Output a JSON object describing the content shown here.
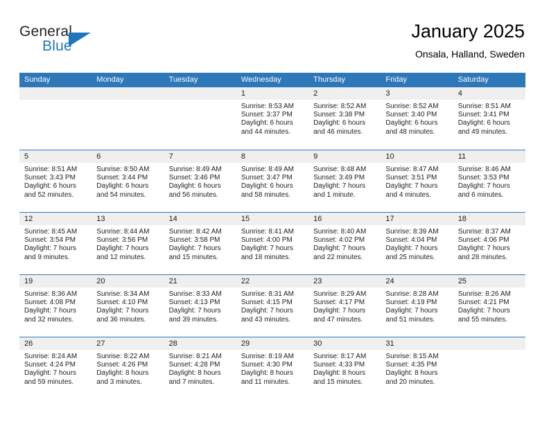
{
  "brand": {
    "name_part1": "General",
    "name_part2": "Blue",
    "flag_icon": "triangle-flag-icon",
    "accent_color": "#1f76bd"
  },
  "header": {
    "title": "January 2025",
    "location": "Onsala, Halland, Sweden"
  },
  "calendar": {
    "header_bg": "#2e77b8",
    "day_band_bg": "#efefef",
    "weekdays": [
      "Sunday",
      "Monday",
      "Tuesday",
      "Wednesday",
      "Thursday",
      "Friday",
      "Saturday"
    ],
    "weeks": [
      [
        {
          "day": "",
          "empty": true
        },
        {
          "day": "",
          "empty": true
        },
        {
          "day": "",
          "empty": true
        },
        {
          "day": "1",
          "sunrise": "Sunrise: 8:53 AM",
          "sunset": "Sunset: 3:37 PM",
          "daylight_line1": "Daylight: 6 hours",
          "daylight_line2": "and 44 minutes."
        },
        {
          "day": "2",
          "sunrise": "Sunrise: 8:52 AM",
          "sunset": "Sunset: 3:38 PM",
          "daylight_line1": "Daylight: 6 hours",
          "daylight_line2": "and 46 minutes."
        },
        {
          "day": "3",
          "sunrise": "Sunrise: 8:52 AM",
          "sunset": "Sunset: 3:40 PM",
          "daylight_line1": "Daylight: 6 hours",
          "daylight_line2": "and 48 minutes."
        },
        {
          "day": "4",
          "sunrise": "Sunrise: 8:51 AM",
          "sunset": "Sunset: 3:41 PM",
          "daylight_line1": "Daylight: 6 hours",
          "daylight_line2": "and 49 minutes."
        }
      ],
      [
        {
          "day": "5",
          "sunrise": "Sunrise: 8:51 AM",
          "sunset": "Sunset: 3:43 PM",
          "daylight_line1": "Daylight: 6 hours",
          "daylight_line2": "and 52 minutes."
        },
        {
          "day": "6",
          "sunrise": "Sunrise: 8:50 AM",
          "sunset": "Sunset: 3:44 PM",
          "daylight_line1": "Daylight: 6 hours",
          "daylight_line2": "and 54 minutes."
        },
        {
          "day": "7",
          "sunrise": "Sunrise: 8:49 AM",
          "sunset": "Sunset: 3:46 PM",
          "daylight_line1": "Daylight: 6 hours",
          "daylight_line2": "and 56 minutes."
        },
        {
          "day": "8",
          "sunrise": "Sunrise: 8:49 AM",
          "sunset": "Sunset: 3:47 PM",
          "daylight_line1": "Daylight: 6 hours",
          "daylight_line2": "and 58 minutes."
        },
        {
          "day": "9",
          "sunrise": "Sunrise: 8:48 AM",
          "sunset": "Sunset: 3:49 PM",
          "daylight_line1": "Daylight: 7 hours",
          "daylight_line2": "and 1 minute."
        },
        {
          "day": "10",
          "sunrise": "Sunrise: 8:47 AM",
          "sunset": "Sunset: 3:51 PM",
          "daylight_line1": "Daylight: 7 hours",
          "daylight_line2": "and 4 minutes."
        },
        {
          "day": "11",
          "sunrise": "Sunrise: 8:46 AM",
          "sunset": "Sunset: 3:53 PM",
          "daylight_line1": "Daylight: 7 hours",
          "daylight_line2": "and 6 minutes."
        }
      ],
      [
        {
          "day": "12",
          "sunrise": "Sunrise: 8:45 AM",
          "sunset": "Sunset: 3:54 PM",
          "daylight_line1": "Daylight: 7 hours",
          "daylight_line2": "and 9 minutes."
        },
        {
          "day": "13",
          "sunrise": "Sunrise: 8:44 AM",
          "sunset": "Sunset: 3:56 PM",
          "daylight_line1": "Daylight: 7 hours",
          "daylight_line2": "and 12 minutes."
        },
        {
          "day": "14",
          "sunrise": "Sunrise: 8:42 AM",
          "sunset": "Sunset: 3:58 PM",
          "daylight_line1": "Daylight: 7 hours",
          "daylight_line2": "and 15 minutes."
        },
        {
          "day": "15",
          "sunrise": "Sunrise: 8:41 AM",
          "sunset": "Sunset: 4:00 PM",
          "daylight_line1": "Daylight: 7 hours",
          "daylight_line2": "and 18 minutes."
        },
        {
          "day": "16",
          "sunrise": "Sunrise: 8:40 AM",
          "sunset": "Sunset: 4:02 PM",
          "daylight_line1": "Daylight: 7 hours",
          "daylight_line2": "and 22 minutes."
        },
        {
          "day": "17",
          "sunrise": "Sunrise: 8:39 AM",
          "sunset": "Sunset: 4:04 PM",
          "daylight_line1": "Daylight: 7 hours",
          "daylight_line2": "and 25 minutes."
        },
        {
          "day": "18",
          "sunrise": "Sunrise: 8:37 AM",
          "sunset": "Sunset: 4:06 PM",
          "daylight_line1": "Daylight: 7 hours",
          "daylight_line2": "and 28 minutes."
        }
      ],
      [
        {
          "day": "19",
          "sunrise": "Sunrise: 8:36 AM",
          "sunset": "Sunset: 4:08 PM",
          "daylight_line1": "Daylight: 7 hours",
          "daylight_line2": "and 32 minutes."
        },
        {
          "day": "20",
          "sunrise": "Sunrise: 8:34 AM",
          "sunset": "Sunset: 4:10 PM",
          "daylight_line1": "Daylight: 7 hours",
          "daylight_line2": "and 36 minutes."
        },
        {
          "day": "21",
          "sunrise": "Sunrise: 8:33 AM",
          "sunset": "Sunset: 4:13 PM",
          "daylight_line1": "Daylight: 7 hours",
          "daylight_line2": "and 39 minutes."
        },
        {
          "day": "22",
          "sunrise": "Sunrise: 8:31 AM",
          "sunset": "Sunset: 4:15 PM",
          "daylight_line1": "Daylight: 7 hours",
          "daylight_line2": "and 43 minutes."
        },
        {
          "day": "23",
          "sunrise": "Sunrise: 8:29 AM",
          "sunset": "Sunset: 4:17 PM",
          "daylight_line1": "Daylight: 7 hours",
          "daylight_line2": "and 47 minutes."
        },
        {
          "day": "24",
          "sunrise": "Sunrise: 8:28 AM",
          "sunset": "Sunset: 4:19 PM",
          "daylight_line1": "Daylight: 7 hours",
          "daylight_line2": "and 51 minutes."
        },
        {
          "day": "25",
          "sunrise": "Sunrise: 8:26 AM",
          "sunset": "Sunset: 4:21 PM",
          "daylight_line1": "Daylight: 7 hours",
          "daylight_line2": "and 55 minutes."
        }
      ],
      [
        {
          "day": "26",
          "sunrise": "Sunrise: 8:24 AM",
          "sunset": "Sunset: 4:24 PM",
          "daylight_line1": "Daylight: 7 hours",
          "daylight_line2": "and 59 minutes."
        },
        {
          "day": "27",
          "sunrise": "Sunrise: 8:22 AM",
          "sunset": "Sunset: 4:26 PM",
          "daylight_line1": "Daylight: 8 hours",
          "daylight_line2": "and 3 minutes."
        },
        {
          "day": "28",
          "sunrise": "Sunrise: 8:21 AM",
          "sunset": "Sunset: 4:28 PM",
          "daylight_line1": "Daylight: 8 hours",
          "daylight_line2": "and 7 minutes."
        },
        {
          "day": "29",
          "sunrise": "Sunrise: 8:19 AM",
          "sunset": "Sunset: 4:30 PM",
          "daylight_line1": "Daylight: 8 hours",
          "daylight_line2": "and 11 minutes."
        },
        {
          "day": "30",
          "sunrise": "Sunrise: 8:17 AM",
          "sunset": "Sunset: 4:33 PM",
          "daylight_line1": "Daylight: 8 hours",
          "daylight_line2": "and 15 minutes."
        },
        {
          "day": "31",
          "sunrise": "Sunrise: 8:15 AM",
          "sunset": "Sunset: 4:35 PM",
          "daylight_line1": "Daylight: 8 hours",
          "daylight_line2": "and 20 minutes."
        },
        {
          "day": "",
          "empty": true
        }
      ]
    ]
  }
}
